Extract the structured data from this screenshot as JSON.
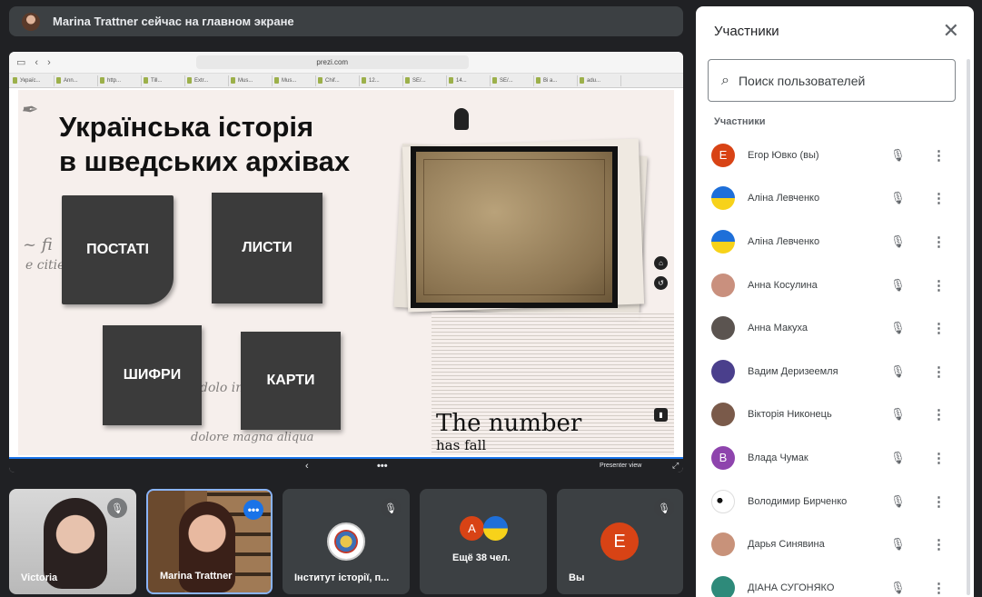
{
  "banner": {
    "text": "Marina Trattner сейчас на главном экране"
  },
  "browser": {
    "url": "prezi.com",
    "tabs": [
      "Україс...",
      "Ann...",
      "http...",
      "Till...",
      "Extr...",
      "Mus...",
      "Mus...",
      "Chif...",
      "12...",
      "SE/...",
      "14...",
      "SE/...",
      "Bi a...",
      "adu..."
    ]
  },
  "slide": {
    "title_line1": "Українська історія",
    "title_line2": "в шведських архівах",
    "cards": {
      "postati": "ПОСТАТІ",
      "lysty": "ЛИСТИ",
      "shyfry": "ШИФРИ",
      "karty": "КАРТИ"
    },
    "news_headline": "The number",
    "news_sub": "has fall"
  },
  "presenter_bar": {
    "chevron": "‹",
    "more": "•••",
    "presenter_view": "Presenter view",
    "fullscreen": "⤢"
  },
  "tiles": [
    {
      "name": "Victoria"
    },
    {
      "name": "Marina Trattner"
    },
    {
      "name": "Інститут історії, п..."
    },
    {
      "name": "Ещё 38 чел.",
      "initial": "А"
    },
    {
      "name": "Вы",
      "initial": "Е"
    }
  ],
  "panel": {
    "title": "Участники",
    "search_placeholder": "Поиск пользователей",
    "section": "Участники",
    "participants": [
      {
        "name": "Егор Ювко (вы)",
        "initial": "Е",
        "color": "#d84315"
      },
      {
        "name": "Аліна Левченко",
        "initial": "",
        "color": "flag"
      },
      {
        "name": "Аліна Левченко",
        "initial": "",
        "color": "flag"
      },
      {
        "name": "Анна Косулина",
        "initial": "",
        "color": "#c9907e"
      },
      {
        "name": "Анна Макуха",
        "initial": "",
        "color": "#5b5450"
      },
      {
        "name": "Вадим Деризеемля",
        "initial": "",
        "color": "#4a3f8c"
      },
      {
        "name": "Вікторія Никонець",
        "initial": "",
        "color": "#7a5a4a"
      },
      {
        "name": "Влада Чумак",
        "initial": "В",
        "color": "#8e44ad"
      },
      {
        "name": "Володимир Бирченко",
        "initial": "",
        "color": "panda"
      },
      {
        "name": "Дарья Синявина",
        "initial": "",
        "color": "#c8927a"
      },
      {
        "name": "ДІАНА СУГОНЯКО",
        "initial": "",
        "color": "#2e8a7a"
      }
    ]
  },
  "colors": {
    "accent": "#1a73e8",
    "bg": "#202124",
    "tile": "#3c4043"
  }
}
